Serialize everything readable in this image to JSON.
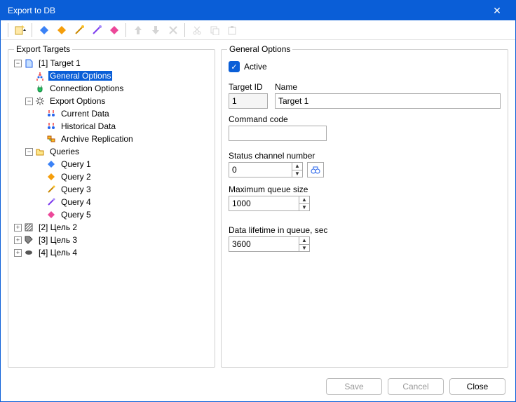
{
  "window": {
    "title": "Export to DB"
  },
  "toolbar_icons": [
    "new",
    "diamond-blue",
    "diamond-orange",
    "wand-orange",
    "wand-purple",
    "diamond-pink",
    "arrow-up",
    "arrow-down",
    "delete",
    "cut",
    "copy",
    "paste"
  ],
  "left_panel": {
    "title": "Export Targets"
  },
  "tree": {
    "root": {
      "label": "[1] Target 1",
      "children": {
        "general": "General Options",
        "connection": "Connection Options",
        "export": {
          "label": "Export Options",
          "children": {
            "current": "Current Data",
            "historical": "Historical Data",
            "archive": "Archive Replication"
          }
        },
        "queries": {
          "label": "Queries",
          "children": {
            "q1": "Query 1",
            "q2": "Query 2",
            "q3": "Query 3",
            "q4": "Query 4",
            "q5": "Query 5"
          }
        }
      }
    },
    "t2": "[2] Цель 2",
    "t3": "[3] Цель 3",
    "t4": "[4] Цель 4"
  },
  "right_panel": {
    "title": "General Options",
    "active_label": "Active",
    "active_checked": true,
    "target_id_label": "Target ID",
    "target_id_value": "1",
    "name_label": "Name",
    "name_value": "Target 1",
    "command_code_label": "Command code",
    "command_code_value": "",
    "status_channel_label": "Status channel number",
    "status_channel_value": "0",
    "max_queue_label": "Maximum queue size",
    "max_queue_value": "1000",
    "lifetime_label": "Data lifetime in queue, sec",
    "lifetime_value": "3600"
  },
  "footer": {
    "save": "Save",
    "cancel": "Cancel",
    "close": "Close"
  }
}
